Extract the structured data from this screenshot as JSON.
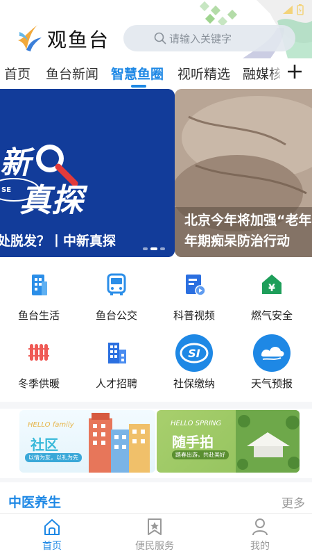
{
  "app": {
    "name": "观鱼台"
  },
  "search": {
    "placeholder": "请输入关键字"
  },
  "tabs": [
    {
      "label": "首页",
      "active": false
    },
    {
      "label": "鱼台新闻",
      "active": false
    },
    {
      "label": "智慧鱼圈",
      "active": true
    },
    {
      "label": "视听精选",
      "active": false
    },
    {
      "label": "融媒核",
      "active": false
    }
  ],
  "banner": {
    "slides": [
      {
        "caption": "处脱发？丨中新真探",
        "art_text_1": "新",
        "art_text_2": "真探",
        "art_badge": "SE"
      },
      {
        "caption_line1": "北京今年将加强“老年",
        "caption_line2": "年期痴呆防治行动"
      }
    ],
    "active_index": 1,
    "count": 3
  },
  "services": [
    {
      "label": "鱼台生活",
      "icon": "building-icon",
      "color": "#2b8ee8"
    },
    {
      "label": "鱼台公交",
      "icon": "bus-icon",
      "color": "#2b8ee8"
    },
    {
      "label": "科普视频",
      "icon": "video-doc-icon",
      "color": "#2b6fe0"
    },
    {
      "label": "燃气安全",
      "icon": "gas-house-icon",
      "color": "#1e9e5a"
    },
    {
      "label": "冬季供暖",
      "icon": "radiator-icon",
      "color": "#ef5a55"
    },
    {
      "label": "人才招聘",
      "icon": "office-building-icon",
      "color": "#2b6fe0"
    },
    {
      "label": "社保缴纳",
      "icon": "social-security-icon",
      "color": "#1e88e5"
    },
    {
      "label": "天气预报",
      "icon": "weather-icon",
      "color": "#1e88e5"
    }
  ],
  "promos": [
    {
      "hello": "HELLO family",
      "title": "社区",
      "subtitle": "以情为友，以礼为先"
    },
    {
      "hello": "HELLO SPRING",
      "title": "随手拍",
      "subtitle": "踏春出游，共赴美好"
    }
  ],
  "section": {
    "title": "中医养生",
    "more": "更多"
  },
  "bottom_nav": [
    {
      "label": "首页",
      "icon": "home-icon",
      "active": true
    },
    {
      "label": "便民服务",
      "icon": "star-bookmark-icon",
      "active": false
    },
    {
      "label": "我的",
      "icon": "user-icon",
      "active": false
    }
  ],
  "colors": {
    "accent": "#1e88e5",
    "banner_blue": "#123c9a"
  }
}
